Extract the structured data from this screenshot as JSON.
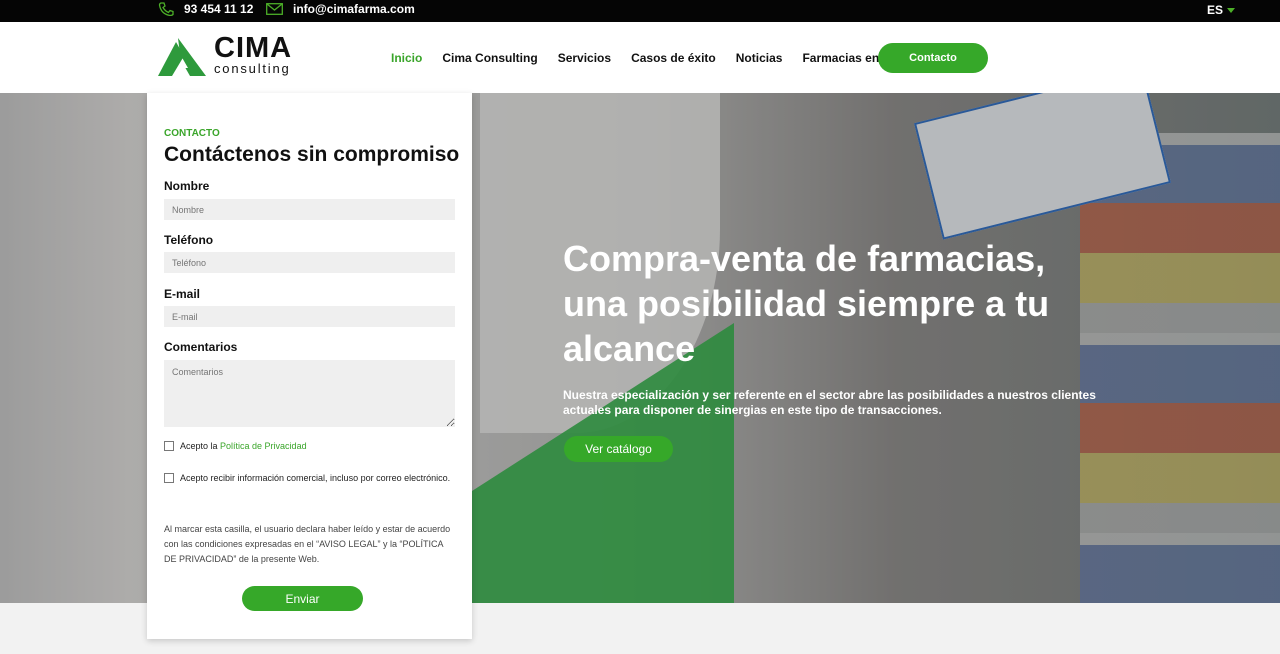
{
  "topbar": {
    "phone": "93 454 11 12",
    "email": "info@cimafarma.com",
    "language": "ES"
  },
  "header": {
    "logo_big": "CIMA",
    "logo_small": "consulting",
    "nav": [
      "Inicio",
      "Cima Consulting",
      "Servicios",
      "Casos de éxito",
      "Noticias",
      "Farmacias en venta"
    ],
    "contact_button": "Contacto"
  },
  "hero": {
    "title": "Compra-venta de farmacias, una posibilidad siempre a tu alcance",
    "lead": "Nuestra especialización y ser referente en el sector abre las posibilidades a nuestros clientes actuales para disponer de sinergias en este tipo de transacciones.",
    "button": "Ver catálogo"
  },
  "form": {
    "eyebrow": "CONTACTO",
    "title": "Contáctenos sin compromiso",
    "fields": {
      "nombre": {
        "label": "Nombre",
        "placeholder": "Nombre"
      },
      "telefono": {
        "label": "Teléfono",
        "placeholder": "Teléfono"
      },
      "email": {
        "label": "E-mail",
        "placeholder": "E-mail"
      },
      "comentarios": {
        "label": "Comentarios",
        "placeholder": "Comentarios"
      }
    },
    "privacy_prefix": "Acepto la ",
    "privacy_link": "Política de Privacidad",
    "commercial": "Acepto recibir información comercial, incluso por correo electrónico.",
    "disclaimer": "Al marcar esta casilla, el usuario declara haber leído y estar de acuerdo con las condiciones expresadas en el “AVISO LEGAL” y la “POLÍTICA DE PRIVACIDAD” de la presente Web.",
    "submit": "Enviar"
  },
  "colors": {
    "accent": "#36a829",
    "topbar": "#050505"
  },
  "icons": [
    "phone-icon",
    "mail-icon",
    "caret-down-icon",
    "logo-triangle-icon"
  ]
}
